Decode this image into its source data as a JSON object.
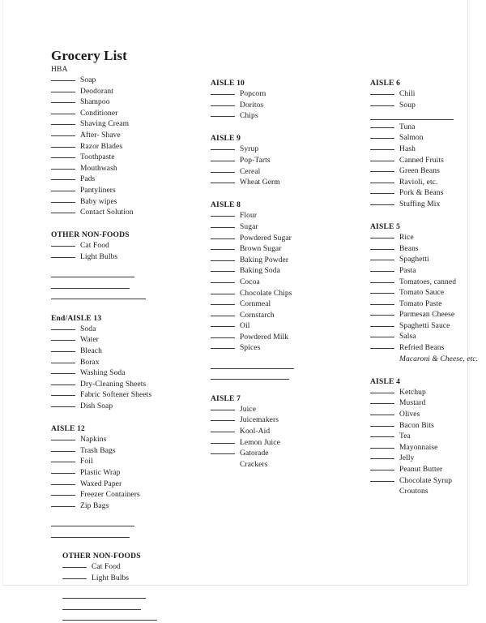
{
  "document": {
    "title": "Grocery List"
  },
  "columns": [
    {
      "name": "column-1",
      "sections": [
        {
          "heading": "HBA",
          "heading_bold": false,
          "items": [
            "Soap",
            "Deodorant",
            "Shampoo",
            "Conditioner",
            "Shaving Cream",
            "After- Shave",
            "Razor Blades",
            "Toothpaste",
            "Mouthwash",
            "Pads",
            "Pantyliners",
            "Baby wipes",
            "Contact Solution"
          ],
          "blank_lines": 0
        },
        {
          "heading": "OTHER NON-FOODS",
          "heading_bold": true,
          "items": [
            "Cat Food",
            "Light Bulbs"
          ],
          "blank_lines": 3
        },
        {
          "heading": "End/AISLE 13",
          "heading_bold": true,
          "items": [
            "Soda",
            "Water",
            "Bleach",
            "Borax",
            "Washing Soda",
            "Dry-Cleaning Sheets",
            "Fabric Softener Sheets",
            "Dish Soap"
          ],
          "blank_lines": 0
        },
        {
          "heading": "AISLE 12",
          "heading_bold": true,
          "items": [
            "Napkins",
            "Trash Bags",
            "Foil",
            "Plastic Wrap",
            "Waxed Paper",
            "Freezer Containers",
            "Zip Bags"
          ],
          "blank_lines": 2
        },
        {
          "heading": "OTHER NON-FOODS",
          "heading_bold": true,
          "indented": true,
          "items": [
            "Cat Food",
            "Light Bulbs"
          ],
          "blank_lines": 3
        }
      ]
    },
    {
      "name": "column-2",
      "sections": [
        {
          "heading": "AISLE 10",
          "heading_bold": true,
          "items": [
            "Popcorn",
            "Doritos",
            "Chips"
          ],
          "blank_lines": 0
        },
        {
          "heading": "AISLE 9",
          "heading_bold": true,
          "items": [
            "Syrup",
            "Pop-Tarts",
            "Cereal",
            "Wheat Germ"
          ],
          "blank_lines": 0
        },
        {
          "heading": "AISLE 8",
          "heading_bold": true,
          "items": [
            "Flour",
            "Sugar",
            "Powdered Sugar",
            "Brown Sugar",
            "Baking Powder",
            "Baking Soda",
            "Cocoa",
            "Chocolate Chips",
            "Cornmeal",
            "Cornstarch",
            "Oil",
            "Powdered Milk",
            "Spices"
          ],
          "blank_lines": 2
        },
        {
          "heading": "AISLE 7",
          "heading_bold": true,
          "items": [
            "Juice",
            "Juicemakers",
            "Kool-Aid",
            "Lemon Juice",
            "Gatorade"
          ],
          "plain_items": [
            "Crackers"
          ],
          "blank_lines": 0
        }
      ]
    },
    {
      "name": "column-3",
      "sections": [
        {
          "heading": "AISLE 6",
          "heading_bold": true,
          "items": [
            "Chili",
            "Soup"
          ],
          "mid_blank_lines": 1,
          "items_after": [
            "Tuna",
            "Salmon",
            "Hash",
            "Canned Fruits",
            "Green Beans",
            "Ravioli, etc.",
            "Pork & Beans",
            "Stuffing Mix"
          ],
          "blank_lines": 0
        },
        {
          "heading": "AISLE 5",
          "heading_bold": true,
          "items": [
            "Rice",
            "Beans",
            "Spaghetti",
            "Pasta",
            "Tomatoes, canned",
            "Tomato Sauce",
            "Tomato Paste",
            "Parmesan Cheese",
            "Spaghetti Sauce",
            "Salsa",
            "Refried Beans"
          ],
          "italic_items": [
            "Macaroni & Cheese, etc."
          ],
          "blank_lines": 0
        },
        {
          "heading": "AISLE 4",
          "heading_bold": true,
          "items": [
            "Ketchup",
            "Mustard",
            "Olives",
            "Bacon Bits",
            "Tea",
            "Mayonnaise",
            "Jelly",
            "Peanut Butter",
            "Chocolate Syrup"
          ],
          "plain_items": [
            "Croutons"
          ],
          "blank_lines": 0
        }
      ]
    }
  ]
}
